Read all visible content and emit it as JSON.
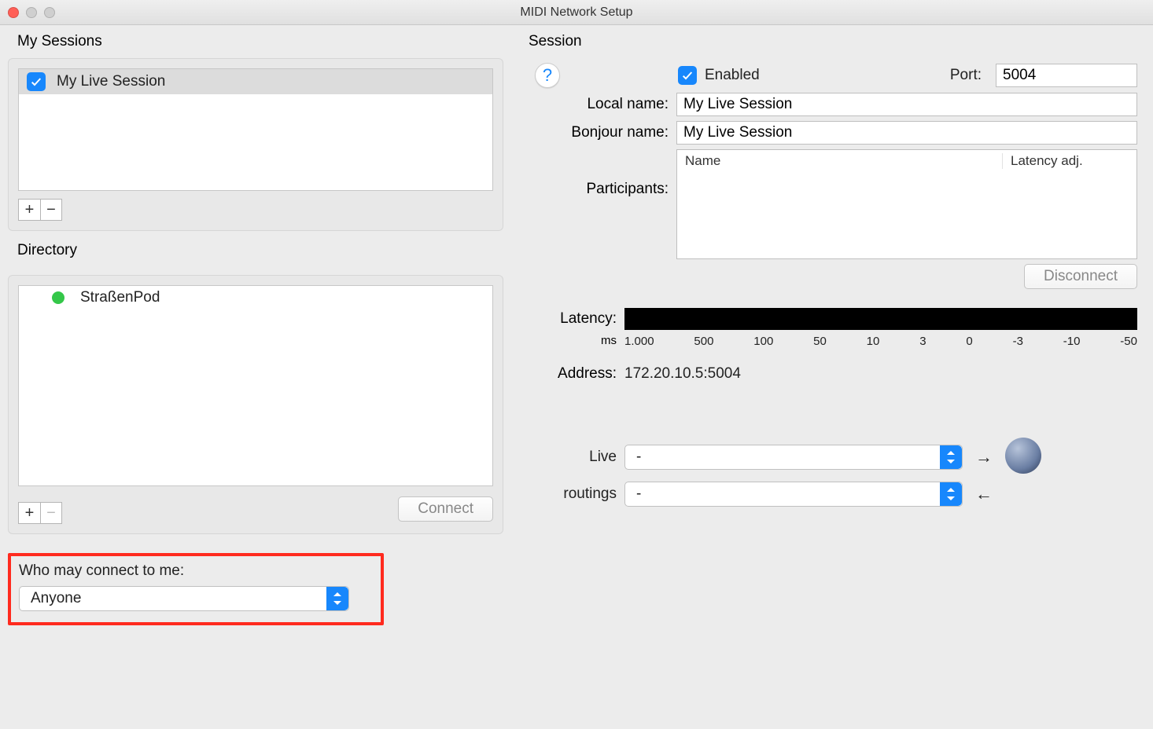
{
  "window": {
    "title": "MIDI Network Setup"
  },
  "left": {
    "my_sessions_label": "My Sessions",
    "sessions": [
      {
        "name": "My Live Session",
        "checked": true
      }
    ],
    "directory_label": "Directory",
    "directory": [
      {
        "name": "StraßenPod",
        "online": true
      }
    ],
    "connect_label": "Connect",
    "who_label": "Who may connect to me:",
    "who_value": "Anyone"
  },
  "right": {
    "session_label": "Session",
    "enabled_label": "Enabled",
    "enabled": true,
    "port_label": "Port:",
    "port_value": "5004",
    "local_name_label": "Local name:",
    "local_name_value": "My Live Session",
    "bonjour_name_label": "Bonjour name:",
    "bonjour_name_value": "My Live Session",
    "participants_label": "Participants:",
    "participants_headers": {
      "name": "Name",
      "latency": "Latency adj."
    },
    "disconnect_label": "Disconnect",
    "latency_label": "Latency:",
    "ms_label": "ms",
    "latency_ticks": [
      "1.000",
      "500",
      "100",
      "50",
      "10",
      "3",
      "0",
      "-3",
      "-10",
      "-50"
    ],
    "address_label": "Address:",
    "address_value": "172.20.10.5:5004",
    "live_routings_label_top": "Live",
    "live_routings_label_bottom": "routings",
    "routing_in_value": "-",
    "routing_out_value": "-"
  }
}
